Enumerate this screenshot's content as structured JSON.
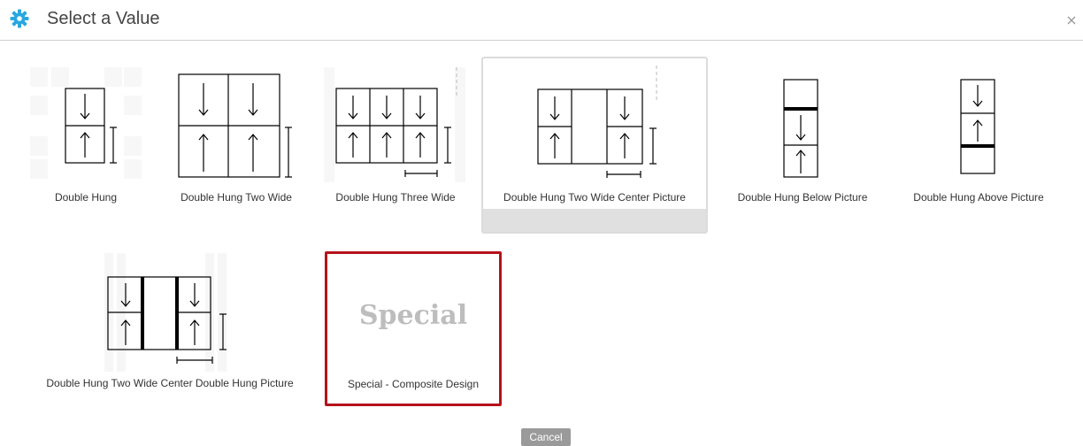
{
  "dialog": {
    "title": "Select a Value",
    "icon": "gear-icon",
    "close_glyph": "×",
    "accent_color": "#2aa7e0"
  },
  "options": [
    {
      "label": "Double Hung",
      "state": "normal"
    },
    {
      "label": "Double Hung Two Wide",
      "state": "normal"
    },
    {
      "label": "Double Hung Three Wide",
      "state": "normal"
    },
    {
      "label": "Double Hung Two Wide Center Picture",
      "state": "hover"
    },
    {
      "label": "Double Hung Below Picture",
      "state": "normal"
    },
    {
      "label": "Double Hung Above Picture",
      "state": "normal"
    },
    {
      "label": "Double Hung Two Wide Center Double Hung Picture",
      "state": "normal"
    },
    {
      "label": "Special - Composite Design",
      "state": "selected",
      "image_text": "Special"
    }
  ],
  "colors": {
    "selected_border": "#b5121b",
    "hover_band": "#e0e0e0",
    "cancel_bg": "#9a9a9a"
  },
  "footer": {
    "cancel_label": "Cancel"
  }
}
